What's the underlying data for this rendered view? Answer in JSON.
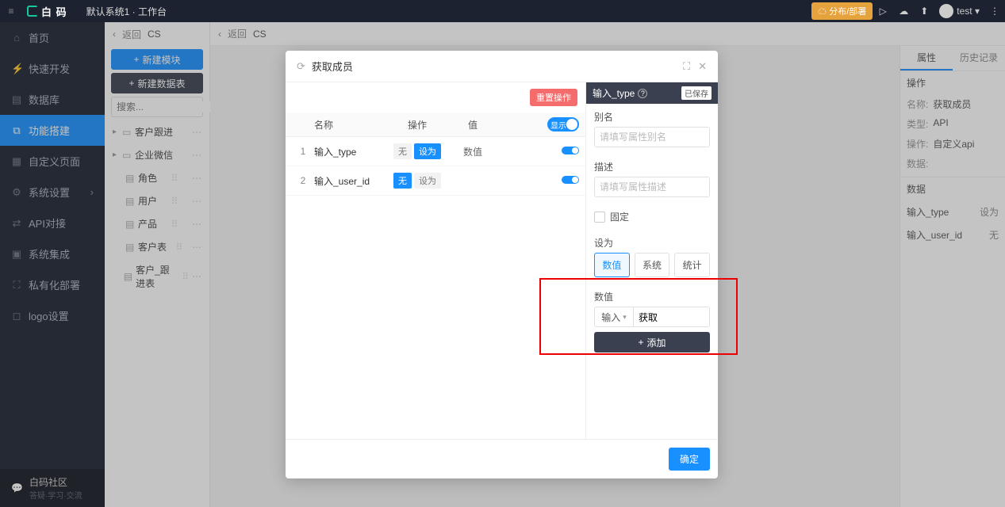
{
  "topbar": {
    "brand": "白 码",
    "breadcrumb": "默认系统1 · 工作台",
    "env_button": "☁ 分布/部署",
    "user": "test ▾"
  },
  "nav": {
    "items": [
      {
        "icon": "⌂",
        "label": "首页"
      },
      {
        "icon": "⚡",
        "label": "快速开发"
      },
      {
        "icon": "▤",
        "label": "数据库"
      },
      {
        "icon": "⧉",
        "label": "功能搭建"
      },
      {
        "icon": "▦",
        "label": "自定义页面"
      },
      {
        "icon": "⚙",
        "label": "系统设置"
      },
      {
        "icon": "⇄",
        "label": "API对接"
      },
      {
        "icon": "▣",
        "label": "系统集成"
      },
      {
        "icon": "⛶",
        "label": "私有化部署"
      },
      {
        "icon": "◻",
        "label": "logo设置"
      }
    ],
    "footer_title": "白码社区",
    "footer_sub": "答疑·学习·交流"
  },
  "col2": {
    "back_label": "返回",
    "current": "CS",
    "btn_new_module": "新建模块",
    "btn_new_table": "新建数据表",
    "search_placeholder": "搜索...",
    "tree": [
      {
        "kind": "folder",
        "label": "客户跟进"
      },
      {
        "kind": "folder",
        "label": "企业微信"
      },
      {
        "kind": "leaf",
        "label": "角色"
      },
      {
        "kind": "leaf",
        "label": "用户"
      },
      {
        "kind": "leaf",
        "label": "产品"
      },
      {
        "kind": "leaf",
        "label": "客户表"
      },
      {
        "kind": "leaf",
        "label": "客户_跟进表"
      }
    ]
  },
  "main_bc": {
    "back": "返回",
    "current": "CS"
  },
  "prop": {
    "tab_attr": "属性",
    "tab_history": "历史记录",
    "section_op": "操作",
    "kv": [
      {
        "k": "名称:",
        "v": "获取成员"
      },
      {
        "k": "类型:",
        "v": "API"
      },
      {
        "k": "操作:",
        "v": "自定义api"
      },
      {
        "k": "数据:",
        "v": ""
      }
    ],
    "section_data": "数据",
    "rows": [
      {
        "name": "输入_type",
        "val": "设为"
      },
      {
        "name": "输入_user_id",
        "val": "无"
      }
    ]
  },
  "modal": {
    "title": "获取成员",
    "reset": "重置操作",
    "thead": {
      "c1": "名称",
      "c2": "操作",
      "c3": "值",
      "toggle": "显示"
    },
    "rows": [
      {
        "idx": "1",
        "name": "输入_type",
        "seg_off": "无",
        "seg_on": "设为",
        "seg_active": "on",
        "value": "数值"
      },
      {
        "idx": "2",
        "name": "输入_user_id",
        "seg_off": "无",
        "seg_on": "设为",
        "seg_active": "off",
        "value": ""
      }
    ],
    "right": {
      "title": "输入_type",
      "saved": "已保存",
      "alias_label": "别名",
      "alias_placeholder": "请填写属性别名",
      "desc_label": "描述",
      "desc_placeholder": "请填写属性描述",
      "fixed_label": "固定",
      "setas_label": "设为",
      "seg_options": [
        "数值",
        "系统",
        "统计"
      ],
      "value_label": "数值",
      "value_select": "输入",
      "value_text": "获取",
      "add_label": "添加"
    },
    "ok": "确定"
  }
}
